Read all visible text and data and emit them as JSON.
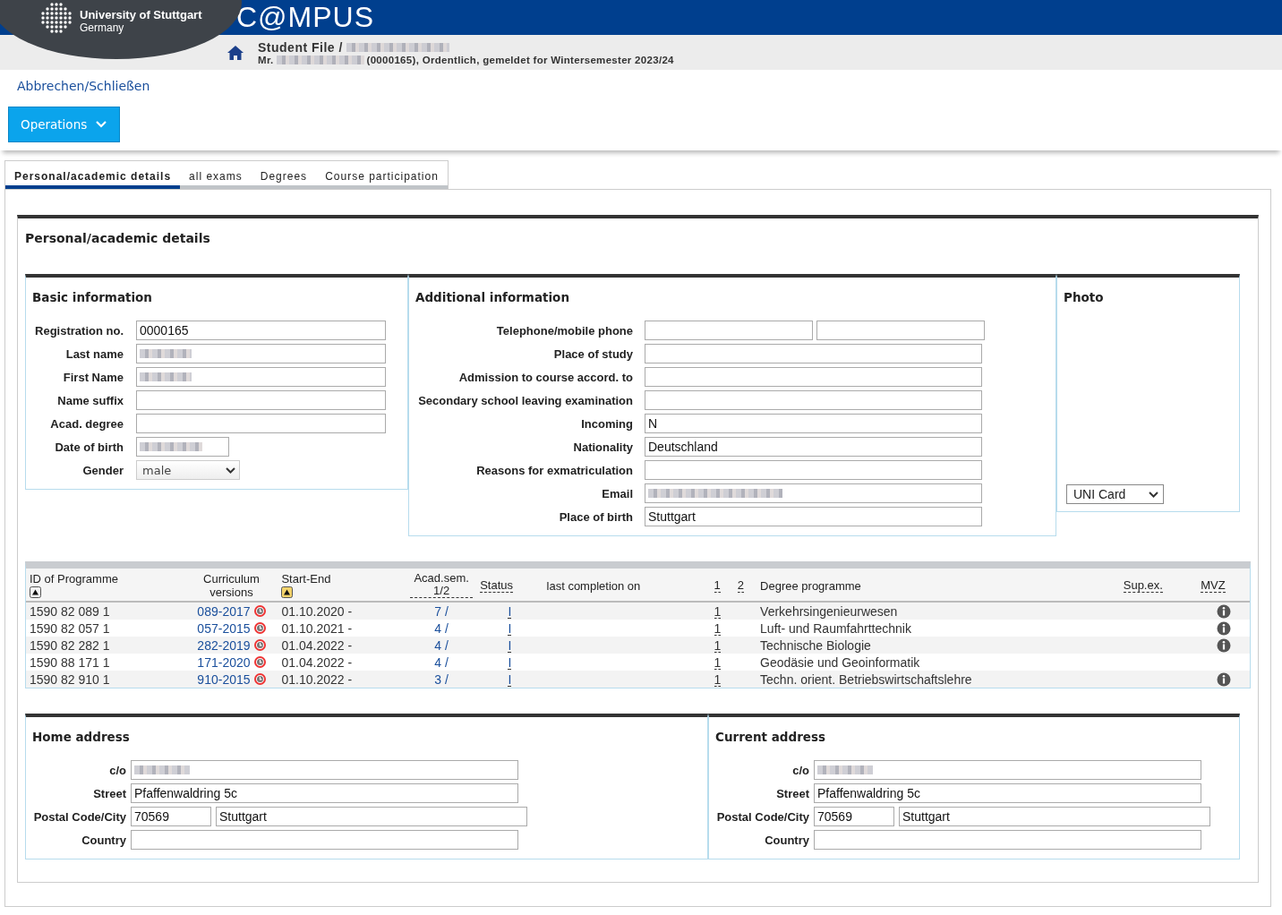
{
  "header": {
    "university": "University of Stuttgart",
    "country": "Germany",
    "app_title": "C@MPUS",
    "breadcrumb_title": "Student File  /",
    "title_redacted": true,
    "salutation": "Mr.",
    "name_redacted": true,
    "subtitle": "(0000165), Ordentlich, gemeldet for Wintersemester 2023/24"
  },
  "cancel_link": "Abbrechen/Schließen",
  "operations_button": "Operations",
  "tabs": [
    {
      "label": "Personal/academic details",
      "selected": true
    },
    {
      "label": "all exams",
      "selected": false
    },
    {
      "label": "Degrees",
      "selected": false
    },
    {
      "label": "Course participation",
      "selected": false
    }
  ],
  "section_title": "Personal/academic details",
  "basic_info": {
    "title": "Basic information",
    "fields": [
      {
        "kind": "text",
        "label": "Registration no.",
        "value": "0000165"
      },
      {
        "kind": "text",
        "label": "Last name",
        "redacted": true
      },
      {
        "kind": "text",
        "label": "First Name",
        "redacted": true
      },
      {
        "kind": "text",
        "label": "Name suffix"
      },
      {
        "kind": "text",
        "label": "Acad. degree"
      },
      {
        "kind": "date",
        "label": "Date of birth",
        "redacted": true
      },
      {
        "kind": "select",
        "label": "Gender",
        "value": "male"
      }
    ]
  },
  "additional_info": {
    "title": "Additional information",
    "fields": [
      {
        "kind": "pair",
        "label": "Telephone/mobile phone"
      },
      {
        "kind": "text",
        "label": "Place of study"
      },
      {
        "kind": "text",
        "label": "Admission to course accord. to"
      },
      {
        "kind": "text",
        "label": "Secondary school leaving examination"
      },
      {
        "kind": "text",
        "label": "Incoming",
        "value": "N"
      },
      {
        "kind": "text",
        "label": "Nationality",
        "value": "Deutschland"
      },
      {
        "kind": "text",
        "label": "Reasons for exmatriculation"
      },
      {
        "kind": "text",
        "label": "Email",
        "redacted": true
      },
      {
        "kind": "text",
        "label": "Place of birth",
        "value": "Stuttgart"
      }
    ]
  },
  "photo": {
    "title": "Photo",
    "select": "UNI Card"
  },
  "programmes": {
    "columns": [
      {
        "label": "ID of Programme",
        "sort": true,
        "active": false
      },
      {
        "label": "Curriculum versions"
      },
      {
        "label": "Start-End",
        "sort": true,
        "active": true
      },
      {
        "label": "Acad.sem. 1/2",
        "dashed": true
      },
      {
        "label": "Status",
        "dashed": true
      },
      {
        "label": "last completion on"
      },
      {
        "label": "1",
        "dashed": true
      },
      {
        "label": "2",
        "dashed": true
      },
      {
        "label": "Degree programme"
      },
      {
        "label": "Sup.ex.",
        "dashed": true
      },
      {
        "label": "MVZ",
        "dashed": true
      }
    ],
    "rows": [
      {
        "id": "1590 82 089 1",
        "version": "089-2017",
        "start": "01.10.2020 -",
        "sem": "7 /",
        "status": "I",
        "col1": "1",
        "programme": "Verkehrsingenieurwesen",
        "info": true
      },
      {
        "id": "1590 82 057 1",
        "version": "057-2015",
        "start": "01.10.2021 -",
        "sem": "4 /",
        "status": "I",
        "col1": "1",
        "programme": "Luft- und Raumfahrttechnik",
        "info": true
      },
      {
        "id": "1590 82 282 1",
        "version": "282-2019",
        "start": "01.04.2022 -",
        "sem": "4 /",
        "status": "I",
        "col1": "1",
        "programme": "Technische Biologie",
        "info": true
      },
      {
        "id": "1590 88 171 1",
        "version": "171-2020",
        "start": "01.04.2022 -",
        "sem": "4 /",
        "status": "I",
        "col1": "1",
        "programme": "Geodäsie und Geoinformatik",
        "info": false
      },
      {
        "id": "1590 82 910 1",
        "version": "910-2015",
        "start": "01.10.2022 -",
        "sem": "3 /",
        "status": "I",
        "col1": "1",
        "programme": "Techn. orient. Betriebswirtschaftslehre",
        "info": true
      }
    ]
  },
  "addresses": [
    {
      "title": "Home address",
      "co_label": "c/o",
      "co_redacted": true,
      "street_label": "Street",
      "street": "Pfaffenwaldring 5c",
      "postal_label": "Postal Code/City",
      "postal_code": "70569",
      "city": "Stuttgart",
      "country_label": "Country"
    },
    {
      "title": "Current address",
      "co_label": "c/o",
      "co_redacted": true,
      "street_label": "Street",
      "street": "Pfaffenwaldring 5c",
      "postal_label": "Postal Code/City",
      "postal_code": "70569",
      "city": "Stuttgart",
      "country_label": "Country"
    }
  ]
}
